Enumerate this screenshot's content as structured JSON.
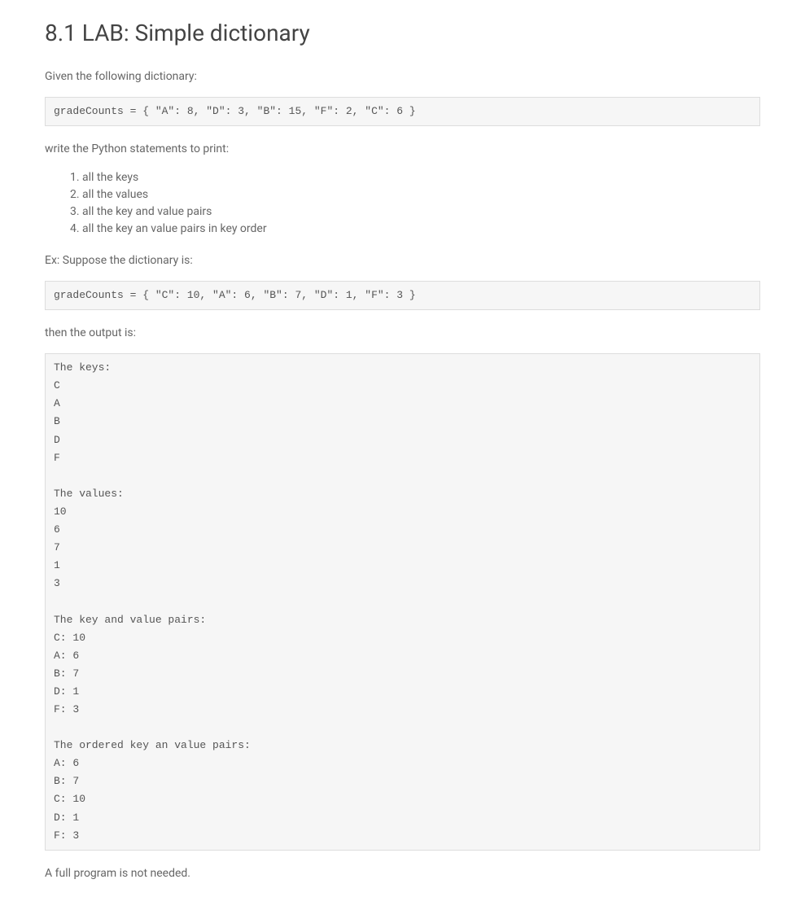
{
  "heading": "8.1 LAB: Simple dictionary",
  "intro_text": "Given the following dictionary:",
  "code1": "gradeCounts = { \"A\": 8, \"D\": 3, \"B\": 15, \"F\": 2, \"C\": 6 }",
  "instructions_text": "write the Python statements to print:",
  "list_items": [
    "all the keys",
    "all the values",
    "all the key and value pairs",
    "all the key an value pairs in key order"
  ],
  "example_intro": "Ex: Suppose the dictionary is:",
  "code2": "gradeCounts = { \"C\": 10, \"A\": 6, \"B\": 7, \"D\": 1, \"F\": 3 }",
  "output_intro": "then the output is:",
  "output_block": "The keys:\nC\nA\nB\nD\nF\n\nThe values:\n10\n6\n7\n1\n3\n\nThe key and value pairs:\nC: 10\nA: 6\nB: 7\nD: 1\nF: 3\n\nThe ordered key an value pairs:\nA: 6\nB: 7\nC: 10\nD: 1\nF: 3",
  "closing_text": "A full program is not needed."
}
